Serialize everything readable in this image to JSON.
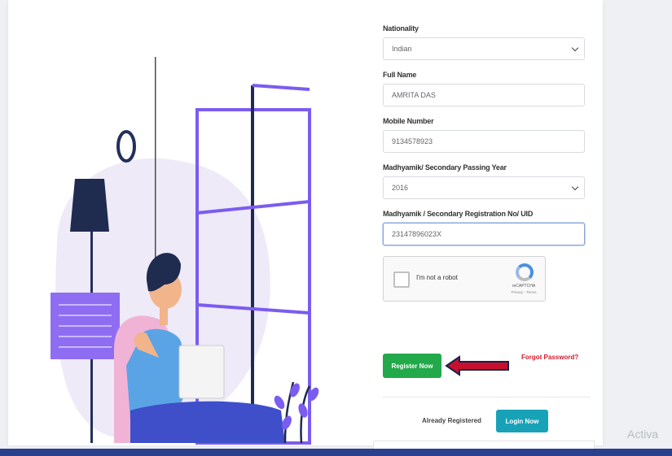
{
  "form": {
    "nationality": {
      "label": "Nationality",
      "value": "Indian"
    },
    "full_name": {
      "label": "Full Name",
      "value": "AMRITA DAS"
    },
    "mobile": {
      "label": "Mobile Number",
      "value": "9134578923"
    },
    "passing_year": {
      "label": "Madhyamik/ Secondary Passing Year",
      "value": "2016"
    },
    "registration": {
      "label": "Madhyamik / Secondary Registration No/ UID",
      "value": "23147896023X"
    },
    "captcha": {
      "label": "I'm not a robot",
      "brand": "reCAPTCHA",
      "terms": "Privacy - Terms"
    },
    "register_label": "Register Now",
    "forgot_label": "Forgot Password?",
    "already_label": "Already Registered",
    "login_label": "Login Now"
  },
  "watermark": "Activa",
  "colors": {
    "register": "#22a94a",
    "login": "#17a2b8",
    "forgot": "#d11a2a",
    "bottom_bar": "#2b3f8f",
    "window_frame": "#7b5cf0",
    "arrow": "#c8102e"
  }
}
